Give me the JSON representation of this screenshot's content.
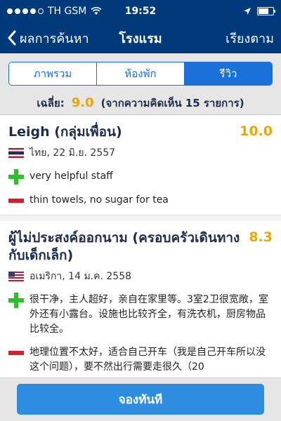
{
  "status": {
    "carrier": "TH GSM",
    "time": "19:52"
  },
  "nav": {
    "back_label": "ผลการค้นหา",
    "title": "โรงแรม",
    "sort_label": "เรียงตาม"
  },
  "tabs": [
    {
      "label": "ภาพรวม"
    },
    {
      "label": "ห้องพัก"
    },
    {
      "label": "รีวิว"
    }
  ],
  "average": {
    "label": "เฉลี่ย:",
    "score": "9.0",
    "count_text": "(จากความคิดเห็น 15 รายการ)"
  },
  "reviews": [
    {
      "name": "Leigh (กลุ่มเพื่อน)",
      "score": "10.0",
      "flag": "thailand-flag",
      "meta": "ไทย, 22 มิ.ย. 2557",
      "positive": "very helpful staff",
      "negative": "thin towels, no sugar for tea"
    },
    {
      "name": "ผู้ไม่ประสงค์ออกนาม (ครอบครัวเดินทางกับเด็กเล็ก)",
      "score": "8.3",
      "flag": "usa-flag",
      "meta": "อเมริกา, 14 ม.ค. 2558",
      "positive": "很干净，主人超好，亲自在家里等。3室2卫很宽敞，室外还有小露台。设施也比较齐全，有洗衣机，厨房物品比较全。",
      "negative": "地理位置不太好，适合自己开车（我是自己开车所以没这个问题），要不然出行需要走很久（20"
    }
  ],
  "book_label": "จองทันที",
  "colors": {
    "header": "#003a7a",
    "accent": "#1a6fd8",
    "score": "#f0a500",
    "plus": "#2cbf2c",
    "minus": "#d4202e"
  }
}
